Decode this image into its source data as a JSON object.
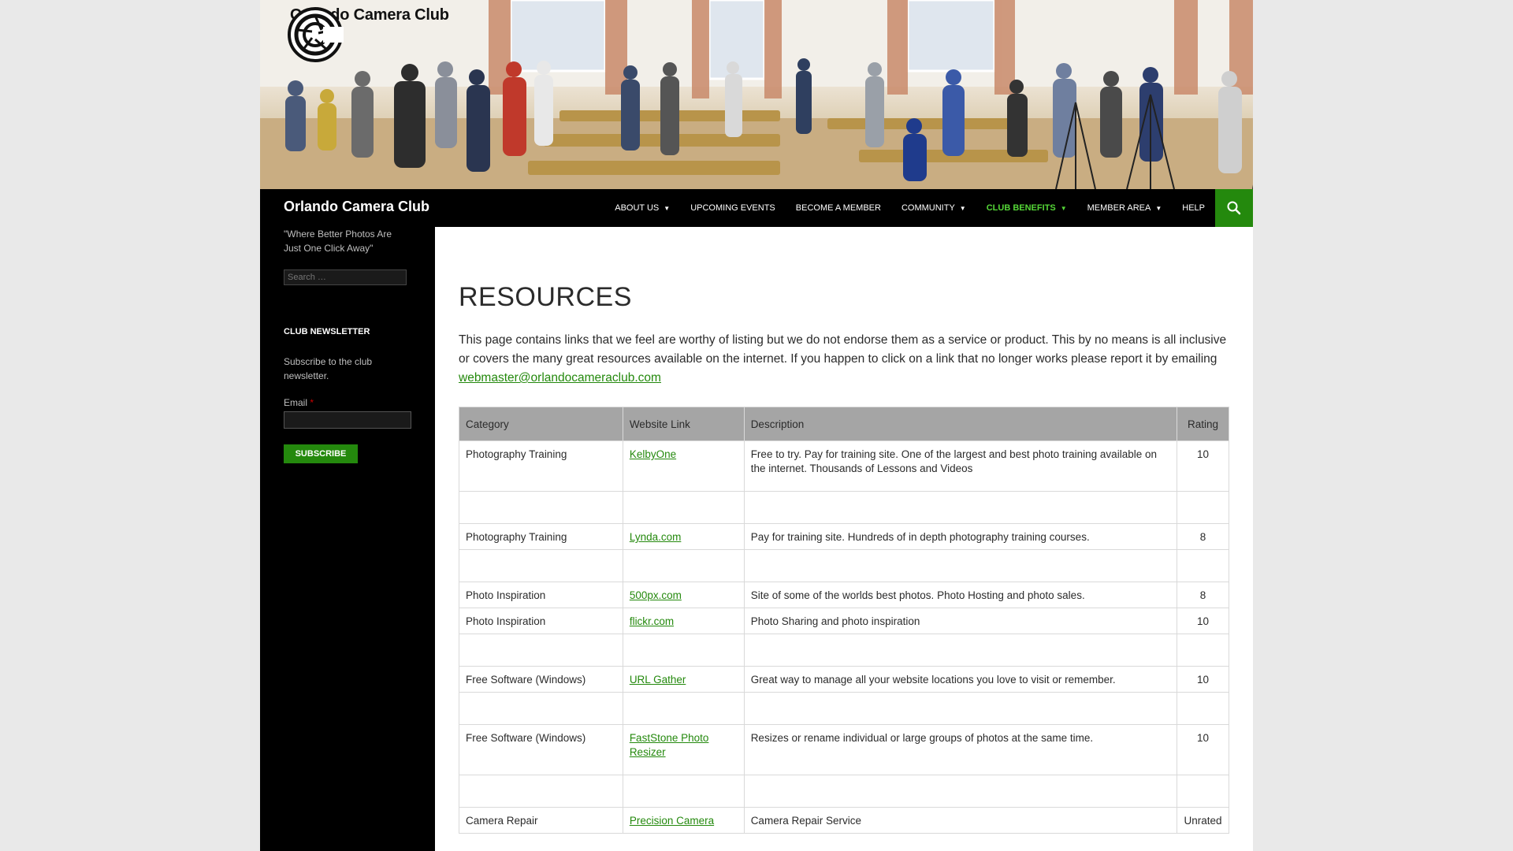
{
  "header": {
    "logo_text": "Orlando Camera Club"
  },
  "navbar": {
    "site_title": "Orlando Camera Club",
    "menu": [
      {
        "label": "About Us",
        "has_dropdown": true,
        "active": false
      },
      {
        "label": "Upcoming Events",
        "has_dropdown": false,
        "active": false
      },
      {
        "label": "Become a Member",
        "has_dropdown": false,
        "active": false
      },
      {
        "label": "Community",
        "has_dropdown": true,
        "active": false
      },
      {
        "label": "Club Benefits",
        "has_dropdown": true,
        "active": true
      },
      {
        "label": "Member Area",
        "has_dropdown": true,
        "active": false
      },
      {
        "label": "Help",
        "has_dropdown": false,
        "active": false
      }
    ],
    "search_icon": "search-icon"
  },
  "sidebar": {
    "tagline": "\"Where Better Photos Are Just One Click Away\"",
    "search_placeholder": "Search …",
    "newsletter_title": "Club Newsletter",
    "newsletter_text": "Subscribe to the club newsletter.",
    "email_label": "Email",
    "email_required_mark": "*",
    "subscribe_label": "Subscribe"
  },
  "main": {
    "page_title": "Resources",
    "intro": "This page contains links that we feel are worthy of listing but we do not endorse them as a service or product.  This by no means is all inclusive or covers the many great resources available on the internet.  If you happen to click on a link that no longer works please report it by emailing",
    "intro_email": "webmaster@orlandocameraclub.com",
    "table": {
      "headers": [
        "Category",
        "Website Link",
        "Description",
        "Rating"
      ],
      "rows": [
        {
          "category": "Photography Training",
          "link": "KelbyOne",
          "description": " Free to try. Pay for training site. One of the largest and best photo training available on the internet.  Thousands of Lessons and Videos",
          "rating": "10"
        },
        {
          "spacer": true
        },
        {
          "category": "Photography Training",
          "link": "Lynda.com",
          "description": " Pay for training site.  Hundreds of in depth photography training courses.",
          "rating": "8"
        },
        {
          "spacer": true
        },
        {
          "category": "Photo Inspiration",
          "link": "500px.com",
          "description": "Site of some of the worlds best photos.  Photo Hosting and photo sales.",
          "rating": "8"
        },
        {
          "category": "Photo Inspiration",
          "link": "flickr.com",
          "description": "Photo Sharing and photo inspiration",
          "rating": "10"
        },
        {
          "spacer": true
        },
        {
          "category": "Free Software (Windows)",
          "link": "URL Gather",
          "description": "Great way to manage all your website locations you love to visit or remember.",
          "rating": "10"
        },
        {
          "spacer": true
        },
        {
          "category": "Free Software (Windows)",
          "link": "FastStone Photo Resizer",
          "description": "Resizes or rename individual or large groups of photos at the same time.",
          "rating": "10"
        },
        {
          "spacer": true
        },
        {
          "category": "Camera Repair",
          "link": "Precision Camera",
          "description": "Camera Repair Service",
          "rating": "Unrated"
        }
      ]
    }
  },
  "colors": {
    "accent": "#24890d",
    "active_nav": "#55d737",
    "nav_bg": "#000000",
    "table_header_bg": "#a5a5a5"
  }
}
